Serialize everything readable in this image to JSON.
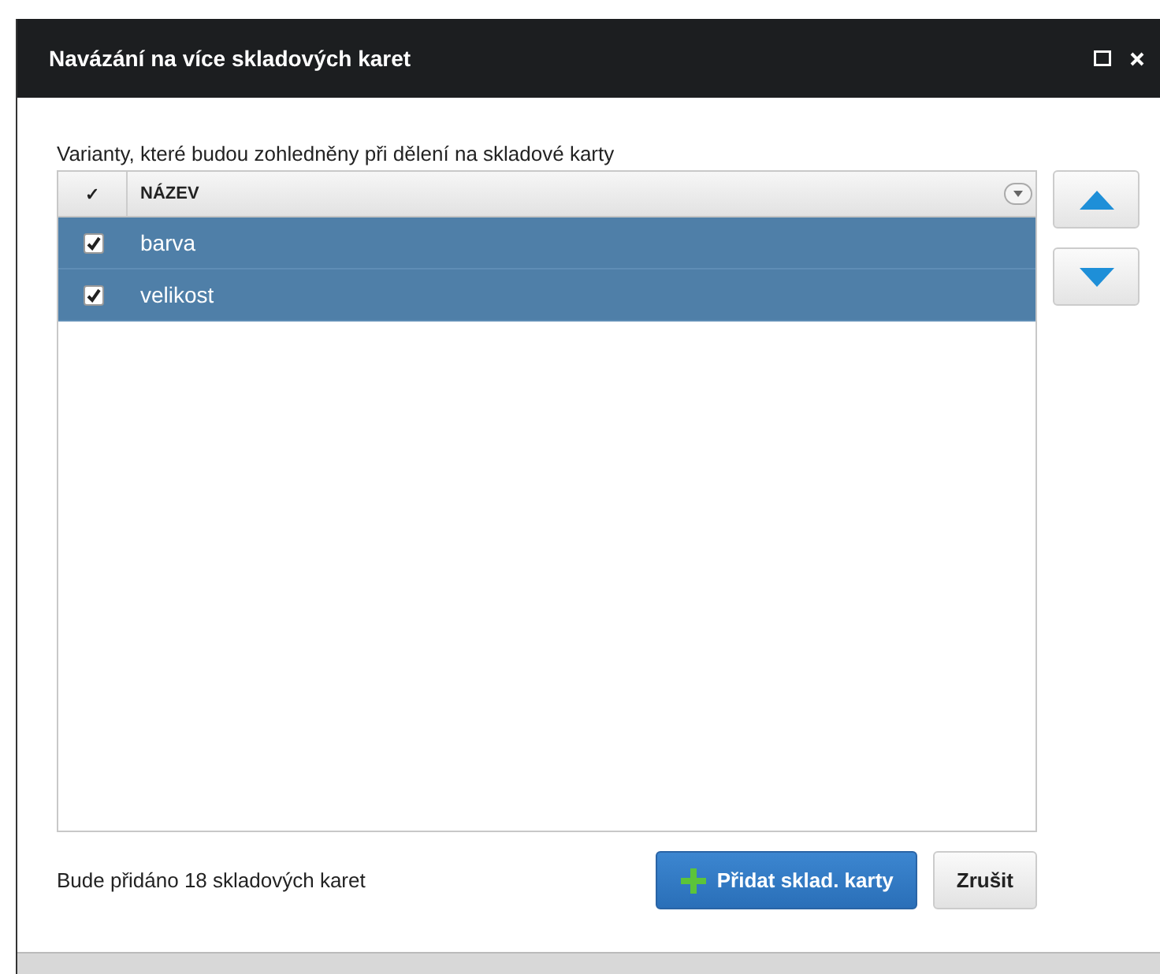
{
  "window": {
    "title": "Navázání na více skladových karet"
  },
  "grid": {
    "caption": "Varianty, které budou zohledněny při dělení na skladové karty",
    "columns": [
      "✓",
      "NÁZEV"
    ],
    "rows": [
      {
        "name": "barva",
        "checked": true,
        "selected": true
      },
      {
        "name": "velikost",
        "checked": true,
        "selected": true
      }
    ]
  },
  "footer": {
    "summary": "Bude přidáno 18 skladových karet",
    "buttons": [
      {
        "label": "Přidat sklad. karty",
        "kind": "primary"
      },
      {
        "label": "Zrušit",
        "kind": "secondary"
      }
    ]
  }
}
